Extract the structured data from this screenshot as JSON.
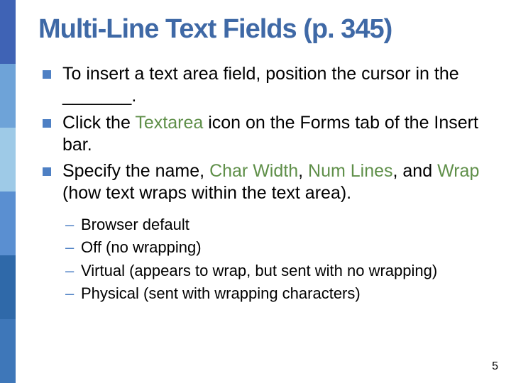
{
  "stripes": [
    "a",
    "b",
    "c",
    "d",
    "e",
    "f"
  ],
  "title": "Multi-Line Text Fields (p. 345)",
  "bullets": [
    {
      "segments": [
        {
          "t": "To insert a text area field, position the cursor in the _______."
        }
      ]
    },
    {
      "segments": [
        {
          "t": "Click the "
        },
        {
          "t": "Textarea",
          "hl": true
        },
        {
          "t": " icon on the Forms tab of the Insert bar."
        }
      ]
    },
    {
      "segments": [
        {
          "t": "Specify the name, "
        },
        {
          "t": "Char Width",
          "hl": true
        },
        {
          "t": ", "
        },
        {
          "t": "Num Lines",
          "hl": true
        },
        {
          "t": ", and "
        },
        {
          "t": "Wrap",
          "hl": true
        },
        {
          "t": " (how text wraps within the text area)."
        }
      ]
    }
  ],
  "sub_bullets": [
    "Browser default",
    "Off (no wrapping)",
    "Virtual (appears to wrap, but sent with no wrapping)",
    "Physical (sent with wrapping characters)"
  ],
  "page_number": "5"
}
